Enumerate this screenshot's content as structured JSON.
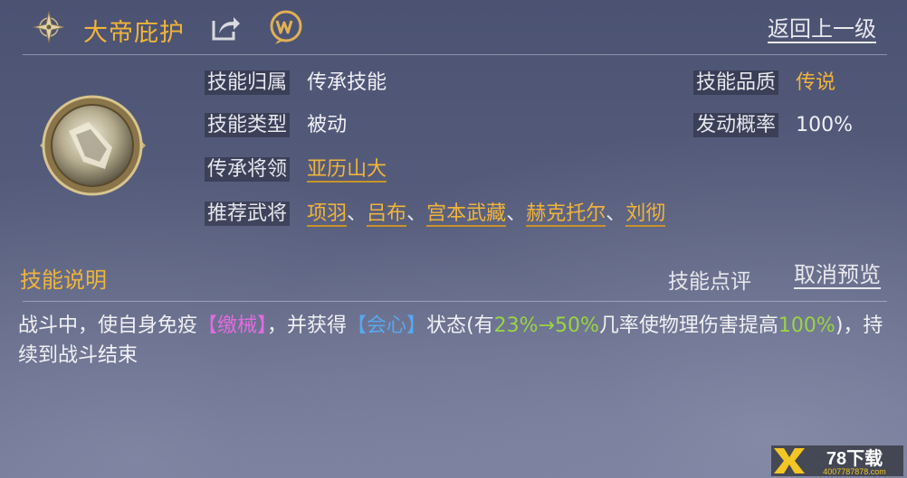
{
  "header": {
    "title": "大帝庇护",
    "back_label": "返回上一级",
    "icons": [
      "compass-icon",
      "share-icon",
      "wiki-icon"
    ]
  },
  "skill": {
    "icon": "skill-orb-icon",
    "belong_label": "技能归属",
    "belong_value": "传承技能",
    "type_label": "技能类型",
    "type_value": "被动",
    "general_label": "传承将领",
    "general_value": "亚历山大",
    "recommend_label": "推荐武将",
    "recommend": [
      "项羽",
      "吕布",
      "宫本武藏",
      "赫克托尔",
      "刘彻"
    ],
    "separator": "、",
    "quality_label": "技能品质",
    "quality_value": "传说",
    "rate_label": "发动概率",
    "rate_value": "100%"
  },
  "description": {
    "section_title": "技能说明",
    "review_label": "技能点评",
    "cancel_label": "取消预览",
    "part1": "战斗中，使自身免疫",
    "immune_tag": "【缴械】",
    "part2": "，并获得",
    "buff_tag": "【会心】",
    "part3": "状态(有",
    "rate_range": "23%→50%",
    "part4": "几率使物理伤害提高",
    "bonus": "100%",
    "part5": ")，持续到战斗结束"
  },
  "watermark": {
    "brand": "78下载",
    "phone": "4007787878.com"
  },
  "colors": {
    "gold": "#f0b43a",
    "pink": "#e26be0",
    "blue": "#58a8ef",
    "green": "#9ad443"
  }
}
